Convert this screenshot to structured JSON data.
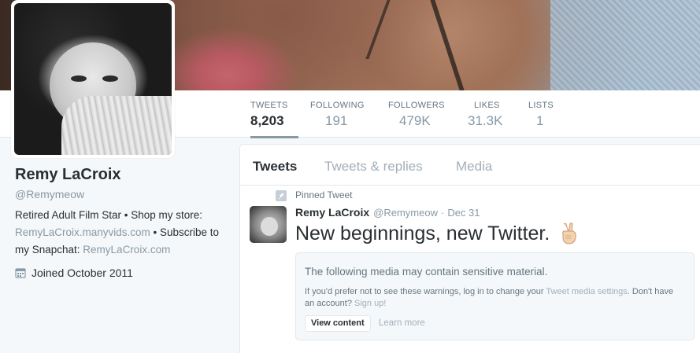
{
  "stats": [
    {
      "label": "TWEETS",
      "value": "8,203",
      "active": true
    },
    {
      "label": "FOLLOWING",
      "value": "191"
    },
    {
      "label": "FOLLOWERS",
      "value": "479K"
    },
    {
      "label": "LIKES",
      "value": "31.3K"
    },
    {
      "label": "LISTS",
      "value": "1"
    }
  ],
  "profile": {
    "name": "Remy LaCroix",
    "handle": "@Remymeow",
    "bio_text_1": "Retired Adult Film Star • Shop my store: ",
    "bio_link_1": "RemyLaCroix.manyvids.com",
    "bio_text_2": " • Subscribe to my Snapchat: ",
    "bio_link_2": "RemyLaCroix.com",
    "joined": "Joined October 2011"
  },
  "timeline": {
    "tabs": [
      "Tweets",
      "Tweets & replies",
      "Media"
    ],
    "pinned_label": "Pinned Tweet",
    "tweet": {
      "name": "Remy LaCroix",
      "handle": "@Remymeow",
      "separator": "·",
      "date": "Dec 31",
      "text": "New beginnings, new Twitter."
    },
    "warning": {
      "title": "The following media may contain sensitive material.",
      "body_1": "If you'd prefer not to see these warnings, log in to change your ",
      "body_link_1": "Tweet media settings",
      "body_2": ". Don't have an account? ",
      "body_link_2": "Sign up!",
      "view_button": "View content",
      "learn_more": "Learn more"
    }
  },
  "icons": {
    "calendar": "calendar-icon",
    "pin": "pin-icon",
    "peace": "victory-hand-emoji-icon"
  },
  "colors": {
    "muted": "#8899a6",
    "text": "#292f33",
    "border": "#e1e8ed",
    "background": "#f5f8fa"
  }
}
